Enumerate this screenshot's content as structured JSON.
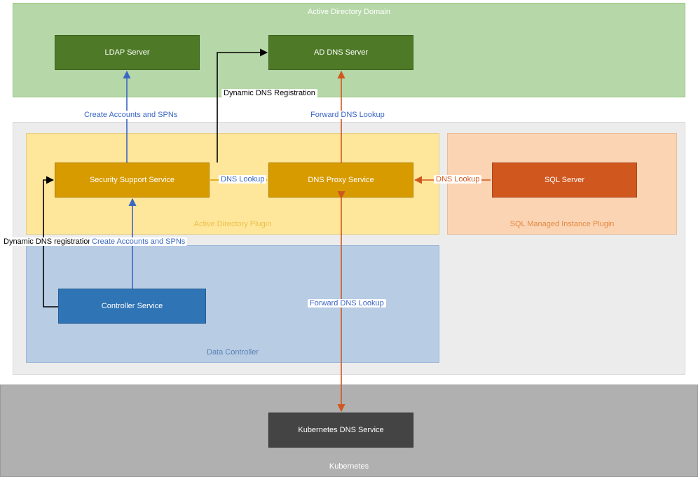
{
  "containers": {
    "adDomain": "Active Directory Domain",
    "grayInner": "",
    "adPlugin": "Active Directory Plugin",
    "sqlPlugin": "SQL Managed Instance Plugin",
    "dataController": "Data Controller",
    "kubernetes": "Kubernetes"
  },
  "nodes": {
    "ldap": "LDAP Server",
    "adDns": "AD DNS Server",
    "sss": "Security Support Service",
    "dnsProxy": "DNS Proxy Service",
    "sqlServer": "SQL Server",
    "controller": "Controller Service",
    "kubeDns": "Kubernetes DNS Service"
  },
  "edges": {
    "createAccounts": "Create Accounts and SPNs",
    "dynamicDns": "Dynamic DNS Registration",
    "dynamicDns2": "Dynamic DNS registration",
    "dnsLookup": "DNS Lookup",
    "forwardDns": "Forward DNS Lookup"
  }
}
